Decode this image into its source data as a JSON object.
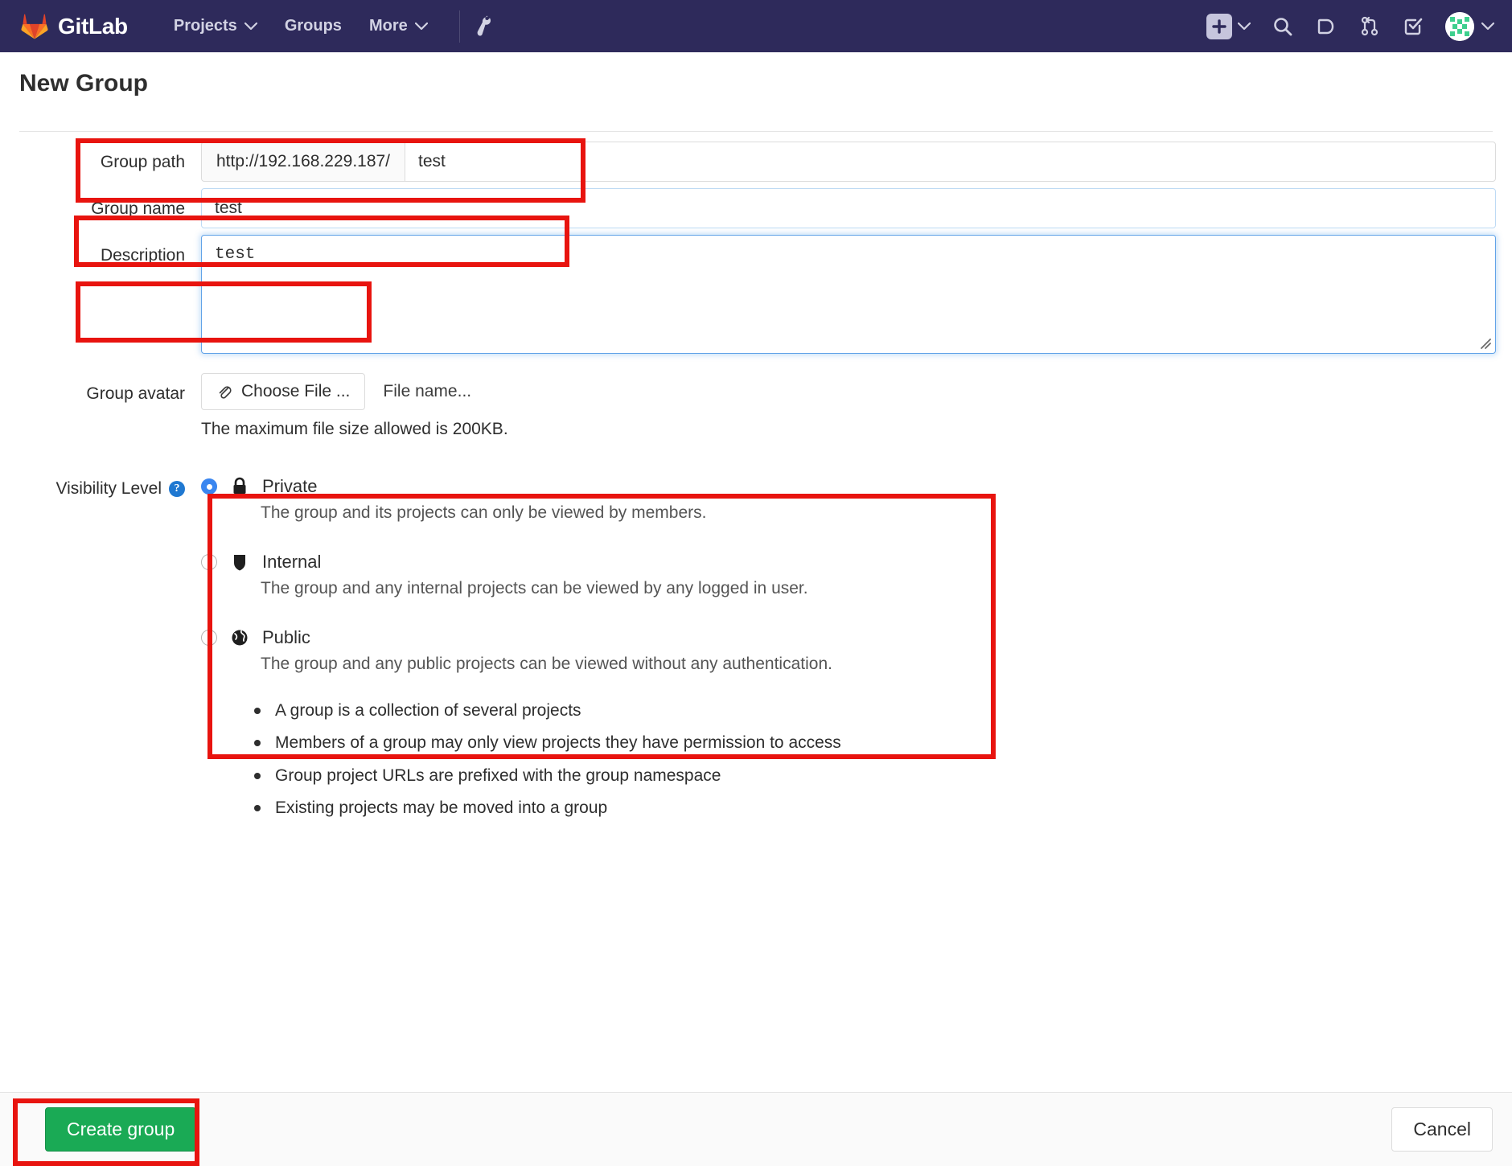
{
  "navbar": {
    "brand": "GitLab",
    "items": [
      {
        "label": "Projects",
        "has_caret": true,
        "icon": ""
      },
      {
        "label": "Groups",
        "has_caret": false,
        "icon": ""
      },
      {
        "label": "More",
        "has_caret": true,
        "icon": ""
      }
    ],
    "admin_icon": "wrench-icon",
    "right_icons": [
      {
        "name": "new-dropdown",
        "icon": "plus-icon"
      },
      {
        "name": "search",
        "icon": "search-icon"
      },
      {
        "name": "issues",
        "icon": "issues-icon"
      },
      {
        "name": "merge-requests",
        "icon": "merge-request-icon"
      },
      {
        "name": "todos",
        "icon": "todo-checkmark-icon"
      },
      {
        "name": "user-menu",
        "icon": "avatar-icon"
      }
    ]
  },
  "page": {
    "title": "New Group"
  },
  "form": {
    "group_path": {
      "label": "Group path",
      "prefix": "http://192.168.229.187/",
      "value": "test",
      "placeholder": ""
    },
    "group_name": {
      "label": "Group name",
      "value": "test",
      "placeholder": ""
    },
    "description": {
      "label": "Description",
      "value": "test",
      "placeholder": ""
    },
    "group_avatar": {
      "label": "Group avatar",
      "choose_button": "Choose File ...",
      "file_name": "File name...",
      "help": "The maximum file size allowed is 200KB."
    },
    "visibility": {
      "label": "Visibility Level",
      "help_icon": "question-mark-icon",
      "selected": "private",
      "options": [
        {
          "id": "private",
          "name": "Private",
          "icon": "lock-icon",
          "description": "The group and its projects can only be viewed by members.",
          "checked": true
        },
        {
          "id": "internal",
          "name": "Internal",
          "icon": "shield-icon",
          "description": "The group and any internal projects can be viewed by any logged in user.",
          "checked": false
        },
        {
          "id": "public",
          "name": "Public",
          "icon": "globe-icon",
          "description": "The group and any public projects can be viewed without any authentication.",
          "checked": false
        }
      ]
    },
    "notes": [
      "A group is a collection of several projects",
      "Members of a group may only view projects they have permission to access",
      "Group project URLs are prefixed with the group namespace",
      "Existing projects may be moved into a group"
    ]
  },
  "footer": {
    "create_label": "Create group",
    "cancel_label": "Cancel"
  },
  "colors": {
    "navbar_bg": "#2e2a5b",
    "create_button": "#1aaa55",
    "annotation": "#e8140f",
    "radio_selected": "#3a86f0",
    "help_icon": "#1f78d1"
  }
}
